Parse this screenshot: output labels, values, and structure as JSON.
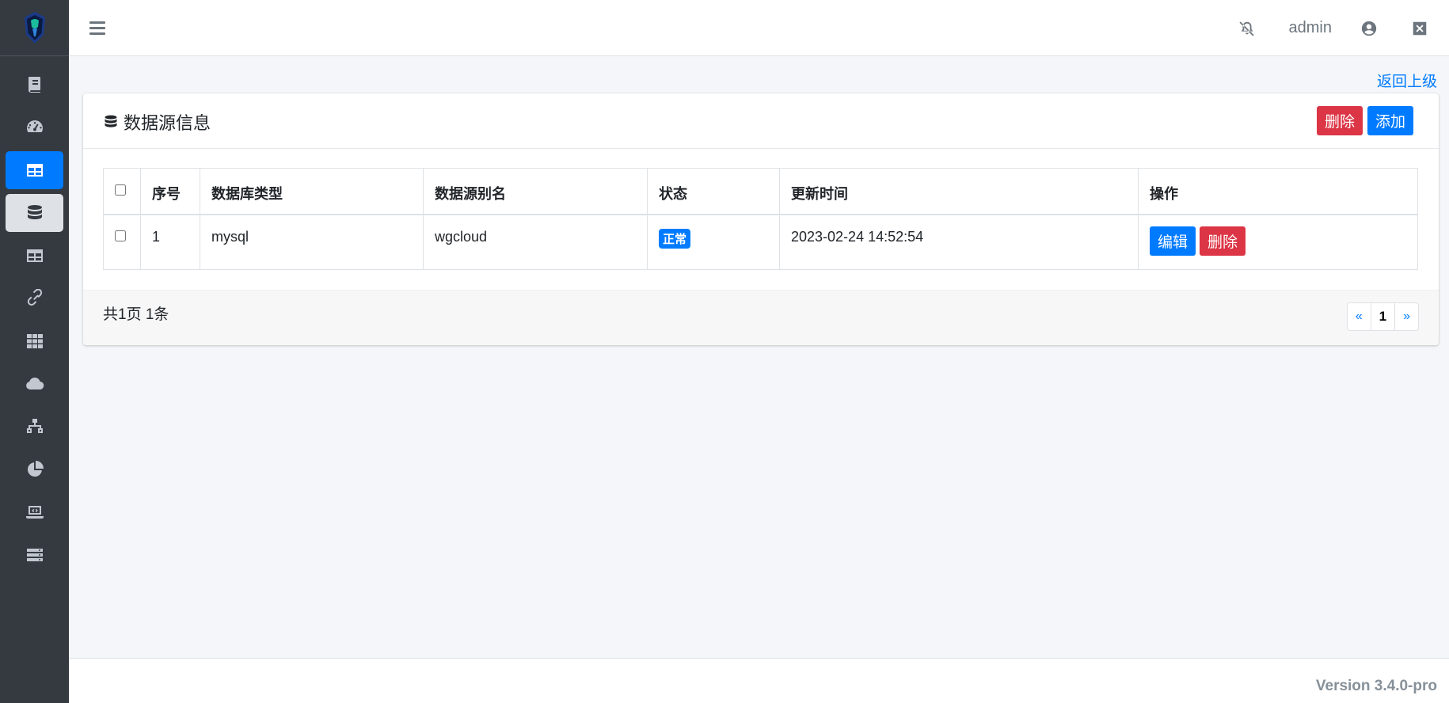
{
  "header": {
    "user_name": "admin"
  },
  "sidebar": {
    "items": [
      {
        "icon": "book-icon",
        "state": "normal"
      },
      {
        "icon": "dashboard-icon",
        "state": "normal"
      },
      {
        "icon": "table-icon",
        "state": "active"
      },
      {
        "icon": "database-icon",
        "state": "open"
      },
      {
        "icon": "table-icon",
        "state": "normal"
      },
      {
        "icon": "link-icon",
        "state": "normal"
      },
      {
        "icon": "grid-icon",
        "state": "normal"
      },
      {
        "icon": "cloud-icon",
        "state": "normal"
      },
      {
        "icon": "network-icon",
        "state": "normal"
      },
      {
        "icon": "pie-chart-icon",
        "state": "normal"
      },
      {
        "icon": "laptop-code-icon",
        "state": "normal"
      },
      {
        "icon": "server-icon",
        "state": "normal"
      }
    ]
  },
  "back_link": "返回上级",
  "card": {
    "title": "数据源信息",
    "delete_label": "删除",
    "add_label": "添加"
  },
  "table": {
    "columns": [
      "序号",
      "数据库类型",
      "数据源别名",
      "状态",
      "更新时间",
      "操作"
    ],
    "rows": [
      {
        "index": "1",
        "db_type": "mysql",
        "alias": "wgcloud",
        "status": "正常",
        "updated": "2023-02-24 14:52:54",
        "edit_label": "编辑",
        "delete_label": "删除"
      }
    ]
  },
  "pagination": {
    "summary": "共1页 1条",
    "prev": "«",
    "current": "1",
    "next": "»"
  },
  "footer": {
    "version": "Version 3.4.0-pro"
  },
  "colors": {
    "primary": "#007bff",
    "danger": "#dc3545",
    "sidebar": "#343a40"
  }
}
